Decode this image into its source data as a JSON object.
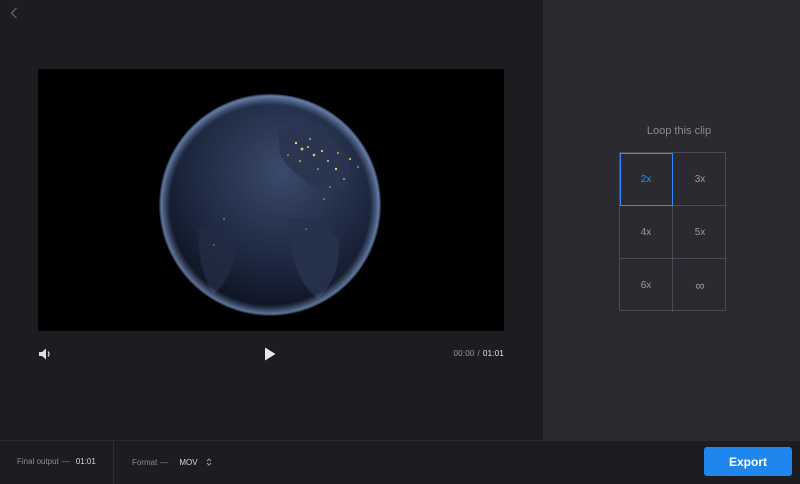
{
  "player": {
    "current_time": "00:00",
    "separator": "/",
    "total_time": "01:01"
  },
  "loop": {
    "title": "Loop this clip",
    "options": [
      "2x",
      "3x",
      "4x",
      "5x",
      "6x",
      "∞"
    ],
    "selected": "2x"
  },
  "footer": {
    "final_output_label": "Final output",
    "final_output_dash": "—",
    "final_output_value": "01:01",
    "format_label": "Format",
    "format_dash": "—",
    "format_value": "MOV",
    "export_label": "Export"
  },
  "colors": {
    "accent": "#1f86ee",
    "selected": "#2d8cff"
  },
  "icons": {
    "back": "chevron-left-icon",
    "volume": "volume-icon",
    "play": "play-icon",
    "format_stepper": "updown-chevron-icon"
  }
}
